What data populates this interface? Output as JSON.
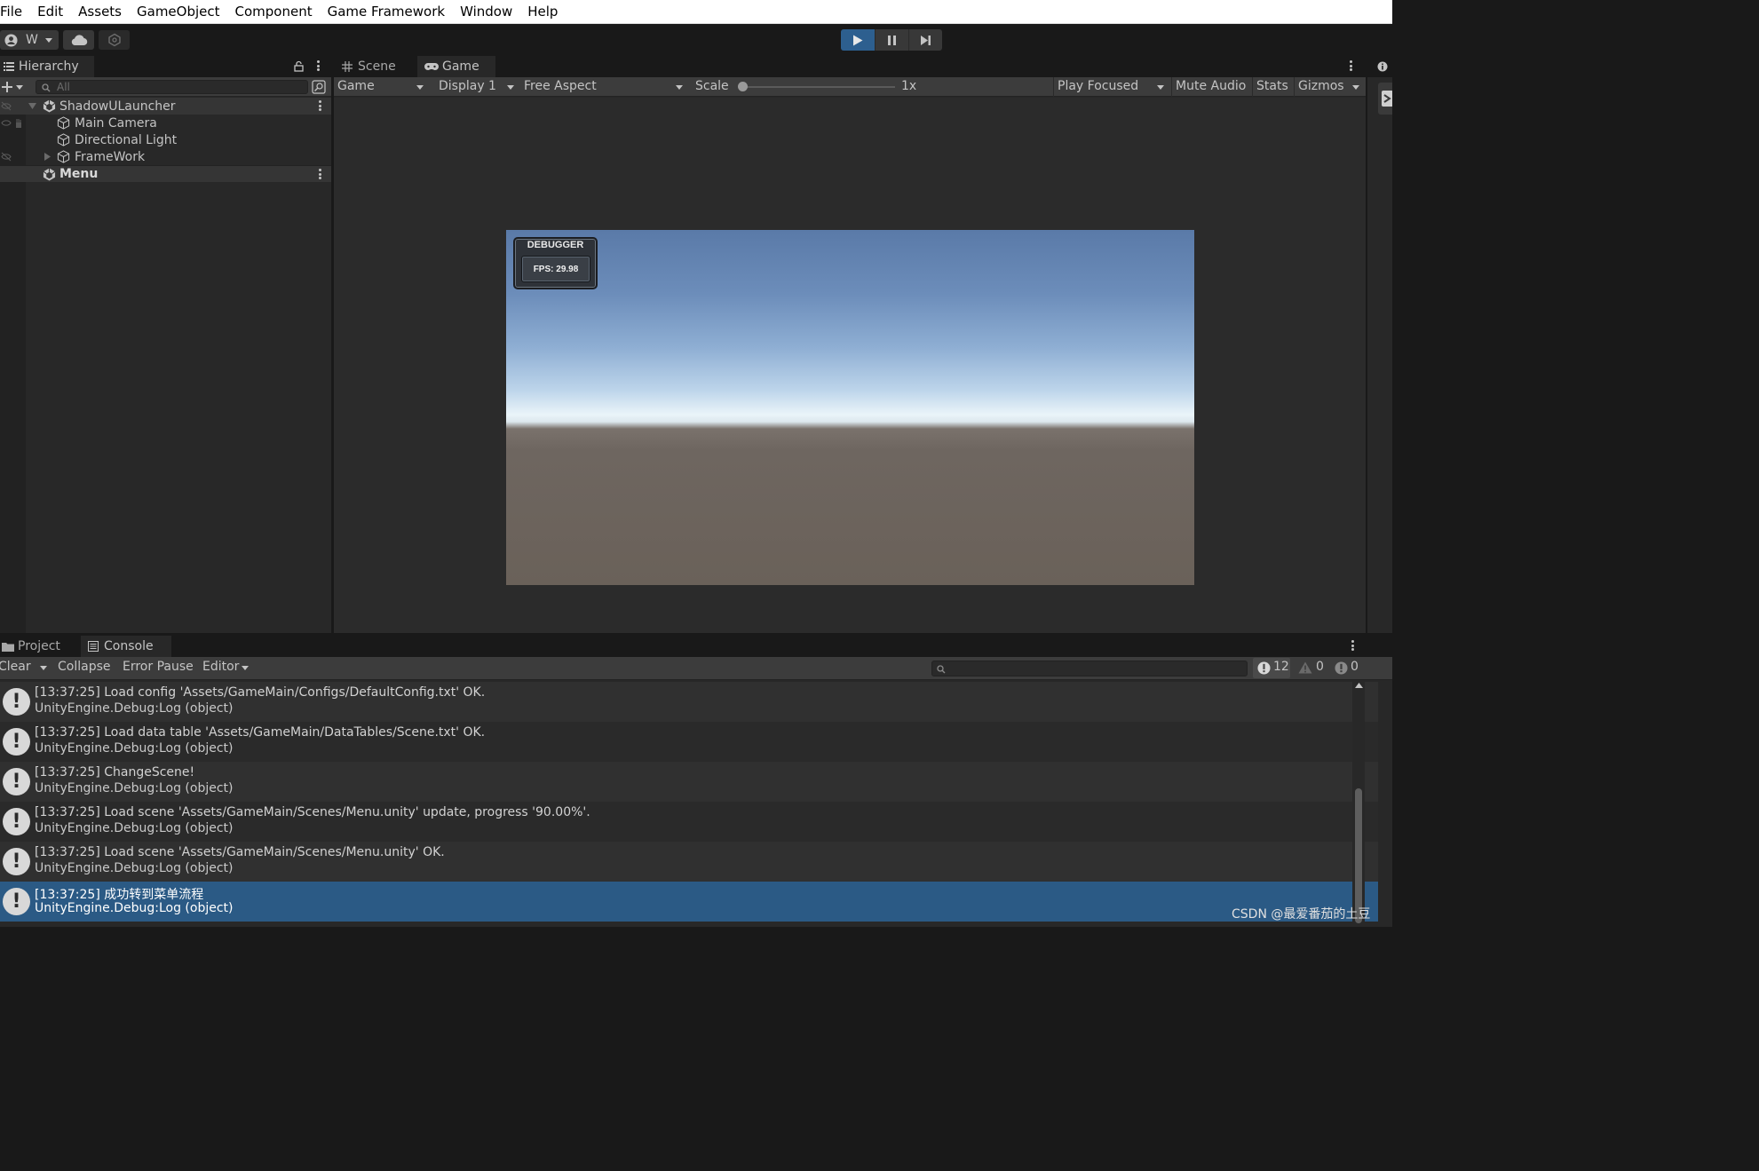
{
  "menu": [
    "File",
    "Edit",
    "Assets",
    "GameObject",
    "Component",
    "Game Framework",
    "Window",
    "Help"
  ],
  "toolbar": {
    "account_label": "W",
    "account_icon": "account-icon",
    "cloud_icon": "cloud-icon",
    "collab_icon": "collab-icon",
    "play_icon": "play-icon",
    "pause_icon": "pause-icon",
    "step_icon": "step-icon",
    "play_active_color": "#2d5f8f"
  },
  "hierarchy": {
    "tab_label": "Hierarchy",
    "search_placeholder": "All",
    "items": [
      {
        "label": "ShadowULauncher",
        "kind": "scene",
        "expanded": true
      },
      {
        "label": "Main Camera",
        "kind": "gameobject"
      },
      {
        "label": "Directional Light",
        "kind": "gameobject"
      },
      {
        "label": "FrameWork",
        "kind": "gameobject",
        "collapsed": true
      },
      {
        "label": "Menu",
        "kind": "scene"
      }
    ]
  },
  "view": {
    "tabs": [
      {
        "label": "Scene",
        "icon": "grid-icon",
        "active": false
      },
      {
        "label": "Game",
        "icon": "gamepad-icon",
        "active": true
      }
    ],
    "game_dropdown": "Game",
    "display": "Display 1",
    "aspect": "Free Aspect",
    "scale_label": "Scale",
    "scale_value": "1x",
    "play_focused": "Play Focused",
    "mute_audio": "Mute Audio",
    "stats": "Stats",
    "gizmos": "Gizmos"
  },
  "debugger": {
    "title": "DEBUGGER",
    "fps": "FPS: 29.98"
  },
  "console": {
    "tabs": [
      {
        "label": "Project",
        "icon": "folder-icon",
        "active": false
      },
      {
        "label": "Console",
        "icon": "console-icon",
        "active": true
      }
    ],
    "clear": "Clear",
    "collapse": "Collapse",
    "error_pause": "Error Pause",
    "editor": "Editor",
    "log_count": "12",
    "warn_count": "0",
    "error_count": "0",
    "entries": [
      {
        "line1": "[13:37:25] Load config 'Assets/GameMain/Configs/DefaultConfig.txt' OK.",
        "line2": "UnityEngine.Debug:Log (object)"
      },
      {
        "line1": "[13:37:25] Load data table 'Assets/GameMain/DataTables/Scene.txt' OK.",
        "line2": "UnityEngine.Debug:Log (object)"
      },
      {
        "line1": "[13:37:25] ChangeScene!",
        "line2": "UnityEngine.Debug:Log (object)"
      },
      {
        "line1": "[13:37:25] Load scene 'Assets/GameMain/Scenes/Menu.unity' update, progress '90.00%'.",
        "line2": "UnityEngine.Debug:Log (object)"
      },
      {
        "line1": "[13:37:25] Load scene 'Assets/GameMain/Scenes/Menu.unity' OK.",
        "line2": "UnityEngine.Debug:Log (object)"
      },
      {
        "line1": "[13:37:25] 成功转到菜单流程",
        "line2": "UnityEngine.Debug:Log (object)",
        "selected": true
      }
    ]
  },
  "watermark": "CSDN @最爱番茄的土豆"
}
